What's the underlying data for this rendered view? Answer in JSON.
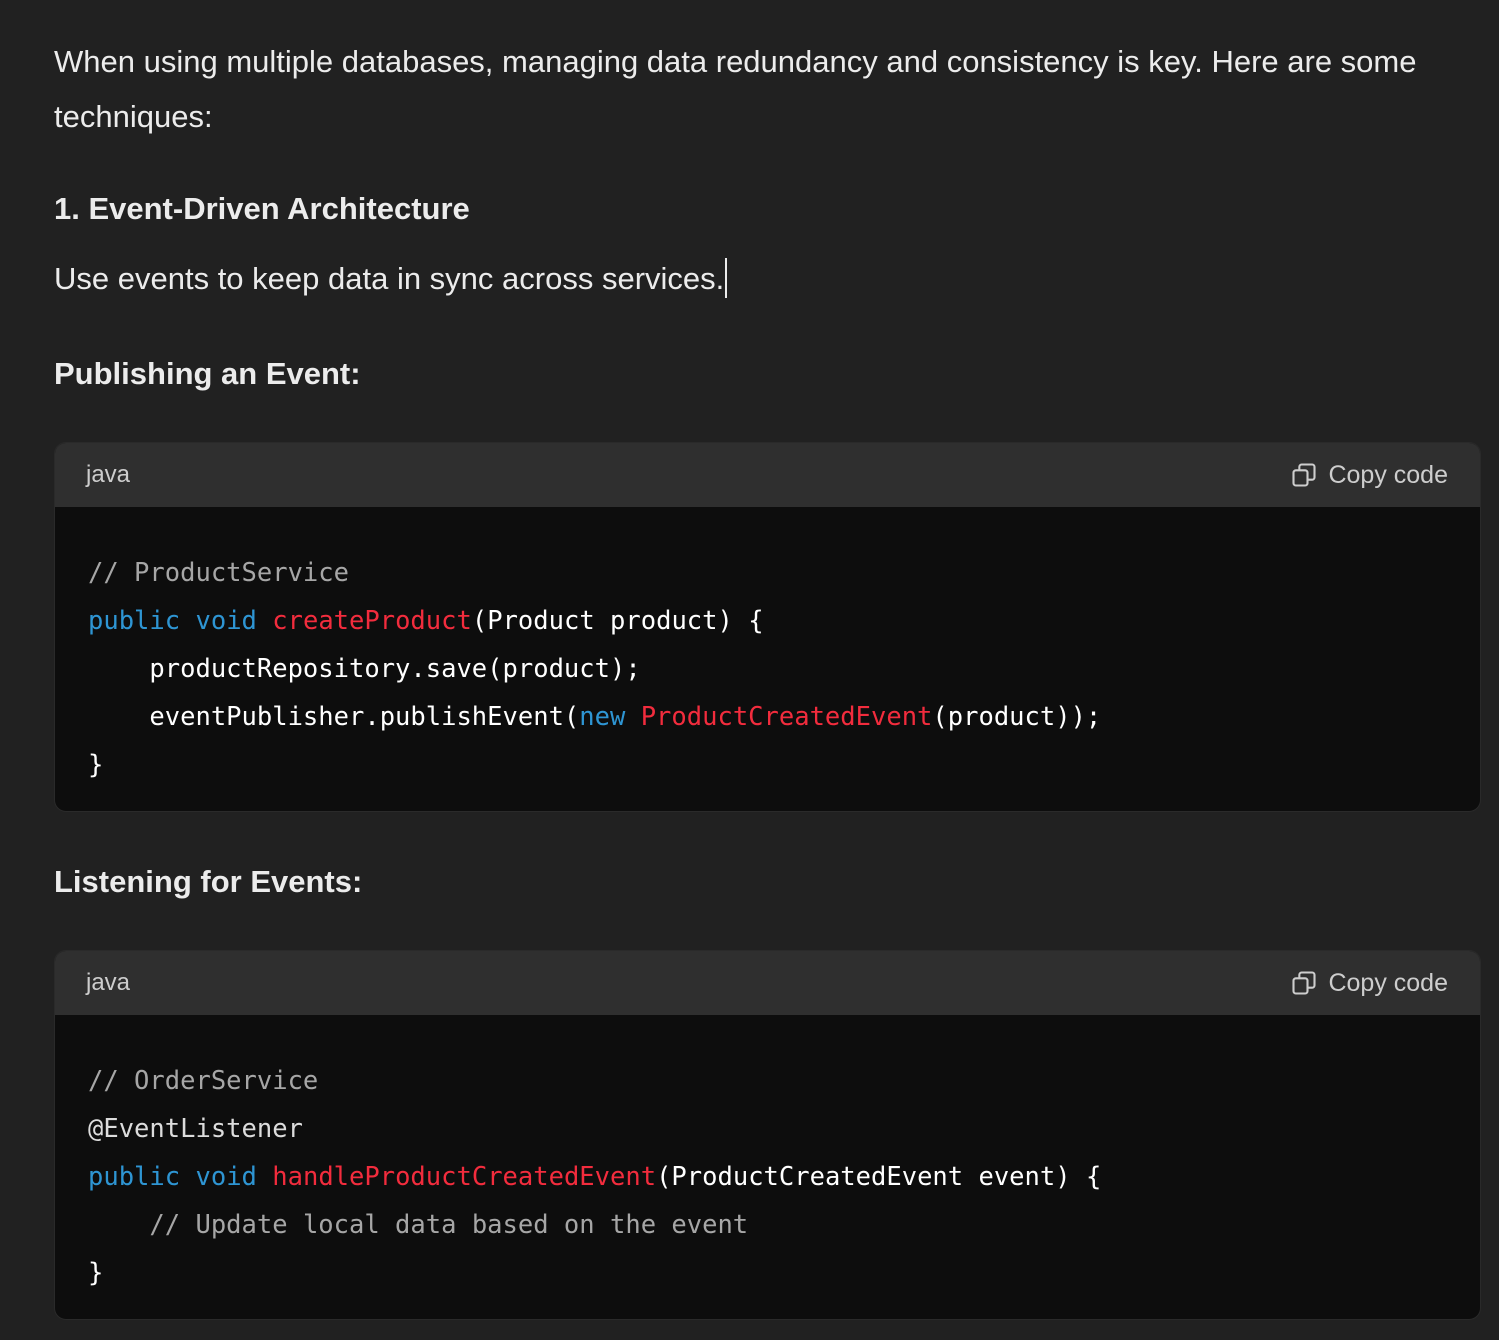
{
  "intro": "When using multiple databases, managing data redundancy and consistency is key. Here are some techniques:",
  "section1": {
    "heading": "1. Event-Driven Architecture",
    "paragraph": "Use events to keep data in sync across services."
  },
  "publishing": {
    "heading": "Publishing an Event:",
    "code": {
      "language": "java",
      "copy_label": "Copy code",
      "lines": [
        [
          {
            "t": "comment",
            "v": "// ProductService"
          }
        ],
        [
          {
            "t": "keyword",
            "v": "public"
          },
          {
            "t": "plain",
            "v": " "
          },
          {
            "t": "keyword",
            "v": "void"
          },
          {
            "t": "plain",
            "v": " "
          },
          {
            "t": "func",
            "v": "createProduct"
          },
          {
            "t": "plain",
            "v": "(Product product) {"
          }
        ],
        [
          {
            "t": "plain",
            "v": "    productRepository.save(product);"
          }
        ],
        [
          {
            "t": "plain",
            "v": "    eventPublisher.publishEvent("
          },
          {
            "t": "keyword",
            "v": "new"
          },
          {
            "t": "plain",
            "v": " "
          },
          {
            "t": "func",
            "v": "ProductCreatedEvent"
          },
          {
            "t": "plain",
            "v": "(product));"
          }
        ],
        [
          {
            "t": "plain",
            "v": "}"
          }
        ]
      ]
    }
  },
  "listening": {
    "heading": "Listening for Events:",
    "code": {
      "language": "java",
      "copy_label": "Copy code",
      "lines": [
        [
          {
            "t": "comment",
            "v": "// OrderService"
          }
        ],
        [
          {
            "t": "annot",
            "v": "@EventListener"
          }
        ],
        [
          {
            "t": "keyword",
            "v": "public"
          },
          {
            "t": "plain",
            "v": " "
          },
          {
            "t": "keyword",
            "v": "void"
          },
          {
            "t": "plain",
            "v": " "
          },
          {
            "t": "func",
            "v": "handleProductCreatedEvent"
          },
          {
            "t": "plain",
            "v": "(ProductCreatedEvent event) {"
          }
        ],
        [
          {
            "t": "plain",
            "v": "    "
          },
          {
            "t": "comment",
            "v": "// Update local data based on the event"
          }
        ],
        [
          {
            "t": "plain",
            "v": "}"
          }
        ]
      ]
    }
  },
  "colors": {
    "background": "#212121",
    "code_header": "#2f2f2f",
    "code_body": "#0d0d0d",
    "keyword": "#2e95d3",
    "function": "#f22c3d",
    "comment": "#a6a6a6"
  },
  "icons": {
    "copy": "copy-icon"
  }
}
